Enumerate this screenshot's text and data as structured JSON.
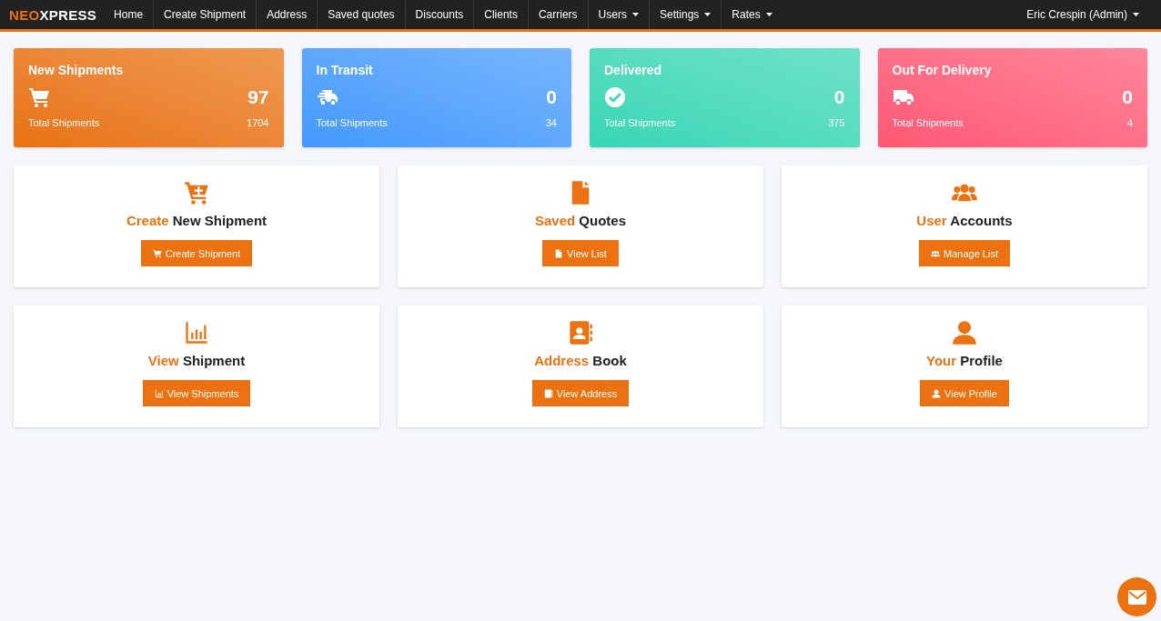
{
  "navbar": {
    "brand_accent": "NEO",
    "brand": "XPRESS",
    "items": [
      {
        "label": "Home",
        "dropdown": false
      },
      {
        "label": "Create Shipment",
        "dropdown": false
      },
      {
        "label": "Address",
        "dropdown": false
      },
      {
        "label": "Saved quotes",
        "dropdown": false
      },
      {
        "label": "Discounts",
        "dropdown": false
      },
      {
        "label": "Clients",
        "dropdown": false
      },
      {
        "label": "Carriers",
        "dropdown": false
      },
      {
        "label": "Users",
        "dropdown": true
      },
      {
        "label": "Settings",
        "dropdown": true
      },
      {
        "label": "Rates",
        "dropdown": true
      }
    ],
    "user": {
      "label": "Eric Crespin (Admin)",
      "dropdown": true
    }
  },
  "stats": [
    {
      "title": "New Shipments",
      "kind": "cart",
      "color": "#e8720c",
      "value": "97",
      "caption": "Total Shipments",
      "total": "1704"
    },
    {
      "title": "In Transit",
      "kind": "fast-truck",
      "color": "#4299fc",
      "value": "0",
      "caption": "Total Shipments",
      "total": "34"
    },
    {
      "title": "Delivered",
      "kind": "check",
      "color": "#35d6b4",
      "value": "0",
      "caption": "Total Shipments",
      "total": "375"
    },
    {
      "title": "Out For Delivery",
      "kind": "truck",
      "color": "#ff5774",
      "value": "0",
      "caption": "Total Shipments",
      "total": "4"
    }
  ],
  "actions": [
    {
      "kind": "cart-plus",
      "accent": "Create",
      "title": "New Shipment",
      "button": "Create Shipment"
    },
    {
      "kind": "file",
      "accent": "Saved",
      "title": "Quotes",
      "button": "View List"
    },
    {
      "kind": "users",
      "accent": "User",
      "title": "Accounts",
      "button": "Manage List"
    },
    {
      "kind": "chart",
      "accent": "View",
      "title": "Shipment",
      "button": "View Shipments"
    },
    {
      "kind": "address-book",
      "accent": "Address",
      "title": "Book",
      "button": "View Address"
    },
    {
      "kind": "user",
      "accent": "Your",
      "title": "Profile",
      "button": "View Profile"
    }
  ]
}
